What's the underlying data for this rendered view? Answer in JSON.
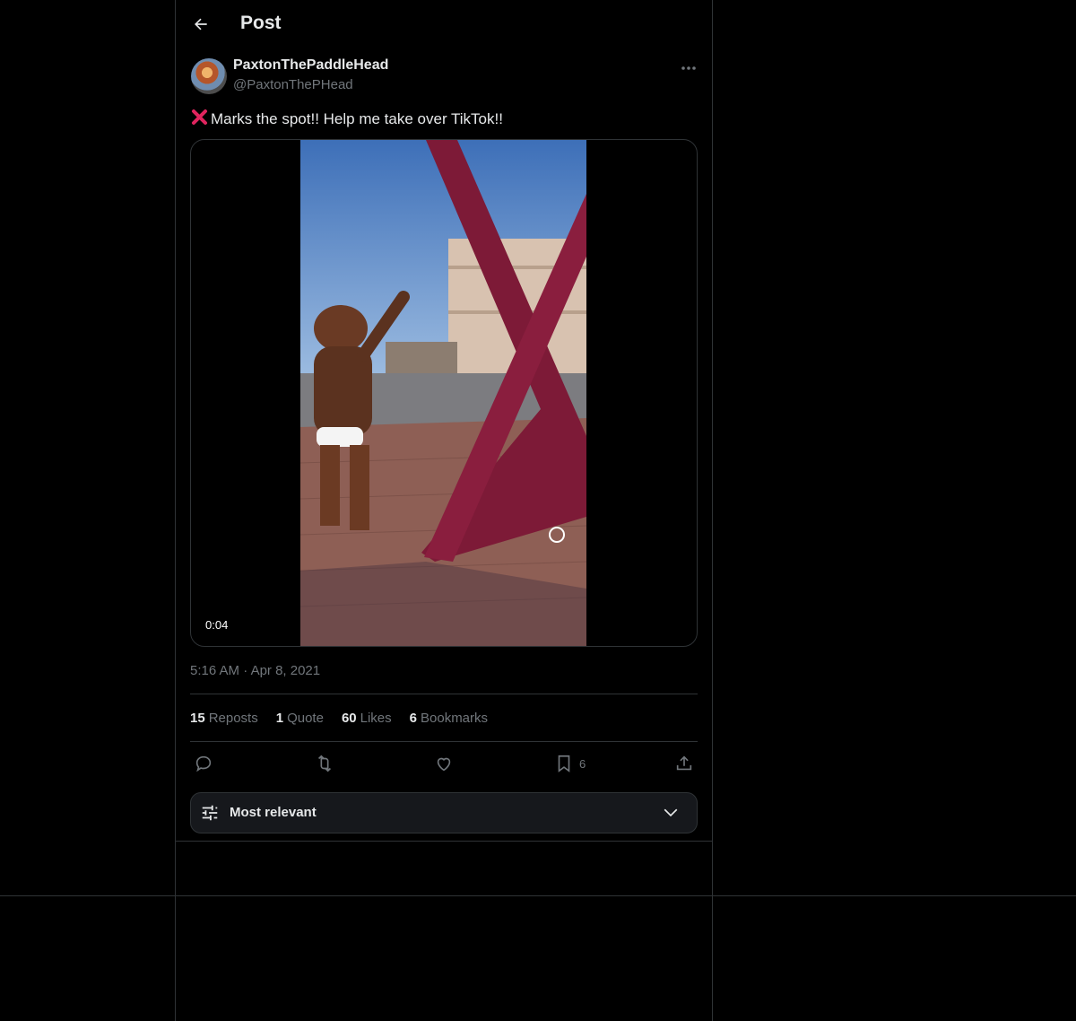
{
  "header": {
    "title": "Post"
  },
  "post": {
    "author_name": "PaxtonThePaddleHead",
    "author_handle": "@PaxtonThePHead",
    "text": "Marks the spot!! Help me take over TikTok!!",
    "text_emoji": "cross-mark-emoji",
    "video_duration": "0:04",
    "time": "5:16 AM",
    "date_sep": "·",
    "date": "Apr 8, 2021"
  },
  "stats": {
    "reposts_count": "15",
    "reposts_label": "Reposts",
    "quotes_count": "1",
    "quotes_label": "Quote",
    "likes_count": "60",
    "likes_label": "Likes",
    "bookmarks_count": "6",
    "bookmarks_label": "Bookmarks"
  },
  "actions": {
    "reply_icon": "reply-icon",
    "repost_icon": "repost-icon",
    "like_icon": "heart-icon",
    "bookmark_icon": "bookmark-icon",
    "bookmark_count": "6",
    "share_icon": "share-icon"
  },
  "sort": {
    "label": "Most relevant"
  },
  "colors": {
    "background": "#000000",
    "border": "#2f3336",
    "muted": "#71767b",
    "text": "#e7e9ea"
  }
}
